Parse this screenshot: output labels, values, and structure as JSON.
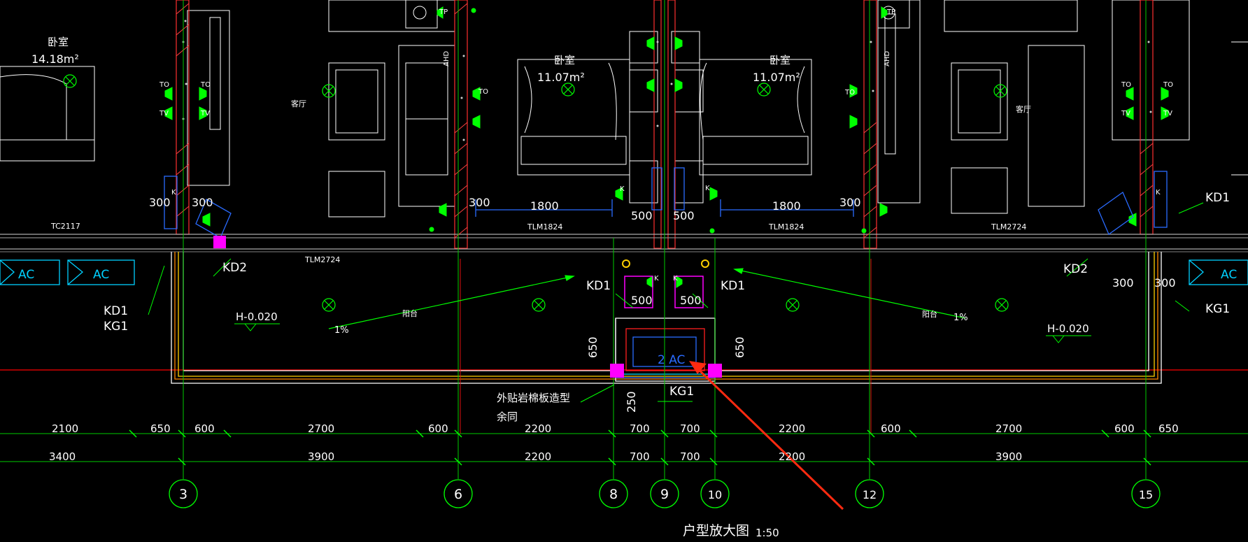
{
  "rooms": {
    "bedroom_left": {
      "name": "卧室",
      "area": "14.18m²"
    },
    "bedroom_mid_left": {
      "name": "卧室",
      "area": "11.07m²"
    },
    "bedroom_mid_right": {
      "name": "卧室",
      "area": "11.07m²"
    },
    "living_left": "客厅",
    "living_right": "客厅",
    "balcony_left": "阳台",
    "balcony_right": "阳台"
  },
  "elevations": {
    "left": "H-0.020",
    "right": "H-0.020"
  },
  "slopes": {
    "left": "1%",
    "right": "1%"
  },
  "window_tags": {
    "tc": "TC2117",
    "tlm_left": "TLM2724",
    "tlm_mid_left": "TLM1824",
    "tlm_mid_right": "TLM1824",
    "tlm_right": "TLM2724"
  },
  "equipment_labels": {
    "ac_left_1": "AC",
    "ac_left_2": "AC",
    "ac_right": "AC",
    "ac_center": "2 AC",
    "kd1": "KD1",
    "kd2": "KD2",
    "kg1": "KG1",
    "to": "TO",
    "tv": "TV",
    "tp": "TP",
    "ahd": "AHD",
    "k": "K"
  },
  "dimensions_local": {
    "d300": "300",
    "d1800": "1800",
    "d500": "500",
    "d650": "650",
    "d250": "250"
  },
  "dimension_row_1": [
    "2100",
    "650",
    "600",
    "2700",
    "600",
    "2200",
    "700",
    "700",
    "2200",
    "600",
    "2700",
    "600",
    "650"
  ],
  "dimension_row_2": [
    "3400",
    "3900",
    "2200",
    "700",
    "700",
    "2200",
    "3900"
  ],
  "axes": [
    "3",
    "6",
    "8",
    "9",
    "10",
    "12",
    "15"
  ],
  "annotation": {
    "line1": "外贴岩棉板造型",
    "line2": "余同"
  },
  "drawing_title": {
    "title": "户型放大图",
    "scale": "1:50"
  },
  "colors": {
    "background": "#000000",
    "axis": "#00ff00",
    "wall_red": "#ff0000",
    "magenta": "#ff00ff",
    "blue": "#2a6bff",
    "cyan": "#00e5ff",
    "yellow": "#ffd000",
    "arrow": "#ff2a10"
  }
}
